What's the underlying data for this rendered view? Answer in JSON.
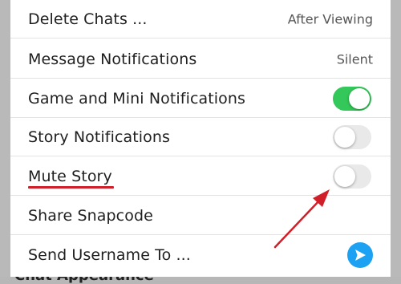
{
  "backdrop": {
    "partial_text": "Chat Appearance"
  },
  "settings": {
    "rows": [
      {
        "label": "Delete Chats ...",
        "value": "After Viewing"
      },
      {
        "label": "Message Notifications",
        "value": "Silent"
      },
      {
        "label": "Game and Mini Notifications",
        "toggle": true
      },
      {
        "label": "Story Notifications",
        "toggle": false
      },
      {
        "label": "Mute Story",
        "toggle": false
      },
      {
        "label": "Share Snapcode"
      },
      {
        "label": "Send Username To ..."
      }
    ]
  },
  "colors": {
    "toggle_on": "#34c759",
    "toggle_off": "#e9e9ea",
    "send_button": "#1da1f2",
    "annotation": "#d11f2a"
  },
  "icons": {
    "send": "send-arrow-icon"
  }
}
